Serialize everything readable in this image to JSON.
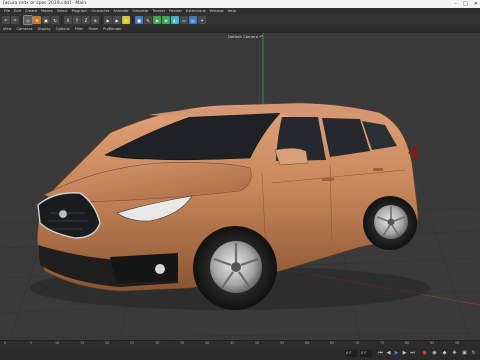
{
  "window": {
    "title": "[acura mdx or spec 2019.c4d] - Main"
  },
  "menubar": {
    "items": [
      "File",
      "Edit",
      "Create",
      "Modes",
      "Select",
      "Mograph",
      "Character",
      "Animate",
      "Simulate",
      "Tracker",
      "Render",
      "Extensions",
      "Window",
      "Help"
    ]
  },
  "toolbar": {
    "buttons": [
      {
        "icon": "undo-icon",
        "glyph": "↶"
      },
      {
        "icon": "redo-icon",
        "glyph": "↷"
      },
      {
        "icon": "live-select-icon",
        "glyph": "◎"
      },
      {
        "icon": "move-icon",
        "glyph": "✥"
      },
      {
        "icon": "scale-icon",
        "glyph": "▣"
      },
      {
        "icon": "rotate-icon",
        "glyph": "↻"
      },
      {
        "icon": "x-axis-icon",
        "glyph": "X"
      },
      {
        "icon": "y-axis-icon",
        "glyph": "Y"
      },
      {
        "icon": "z-axis-icon",
        "glyph": "Z"
      },
      {
        "icon": "coord-system-icon",
        "glyph": "⊕"
      },
      {
        "icon": "render-view-icon",
        "glyph": "▶"
      },
      {
        "icon": "render-picture-viewer-icon",
        "glyph": "▶"
      },
      {
        "icon": "render-settings-icon",
        "glyph": "⚙"
      },
      {
        "icon": "cube-icon",
        "glyph": "■"
      },
      {
        "icon": "pen-icon",
        "glyph": "✎"
      },
      {
        "icon": "subdivision-icon",
        "glyph": "◆"
      },
      {
        "icon": "array-icon",
        "glyph": "✿"
      },
      {
        "icon": "deformer-icon",
        "glyph": "◐"
      },
      {
        "icon": "floor-icon",
        "glyph": "▭"
      },
      {
        "icon": "camera-icon",
        "glyph": "▤"
      },
      {
        "icon": "light-icon",
        "glyph": "✦"
      }
    ]
  },
  "viewmenu": {
    "items": [
      "View",
      "Cameras",
      "Display",
      "Options",
      "Filter",
      "Panel",
      "ProRender"
    ]
  },
  "viewport": {
    "camera_label": "Default Camera •°"
  },
  "timeline": {
    "ticks": [
      "0",
      "5",
      "10",
      "15",
      "20",
      "25",
      "30",
      "35",
      "40",
      "45",
      "50",
      "55",
      "60",
      "65",
      "70",
      "75",
      "80",
      "85",
      "90"
    ]
  },
  "bottombar": {
    "start_frame": "0 F",
    "current_frame": "0 F"
  },
  "colors": {
    "car_body": "#c8875a",
    "grid": "#333333",
    "axis_green": "#3e9a5a",
    "axis_red": "#8a3a3a"
  }
}
